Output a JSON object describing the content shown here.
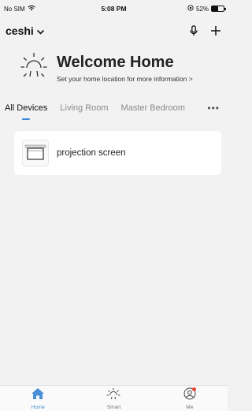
{
  "status_bar": {
    "carrier": "No SIM",
    "time": "5:08 PM",
    "battery_percent": "52%",
    "battery_level": 0.52
  },
  "header": {
    "home_name": "ceshi"
  },
  "welcome": {
    "title": "Welcome Home",
    "subtitle": "Set your home location for more information >"
  },
  "room_tabs": [
    {
      "label": "All Devices",
      "active": true
    },
    {
      "label": "Living Room",
      "active": false
    },
    {
      "label": "Master Bedroom",
      "active": false
    }
  ],
  "devices": [
    {
      "name": "projection screen",
      "icon": "projection-screen-icon"
    }
  ],
  "bottom_tabs": [
    {
      "label": "Home",
      "icon": "home-icon",
      "active": true
    },
    {
      "label": "Smart",
      "icon": "sun-icon",
      "active": false
    },
    {
      "label": "Me",
      "icon": "profile-icon",
      "active": false
    }
  ],
  "colors": {
    "accent": "#4a8fd8",
    "notification_dot": "#e8473a",
    "background": "#f2f2f2"
  }
}
